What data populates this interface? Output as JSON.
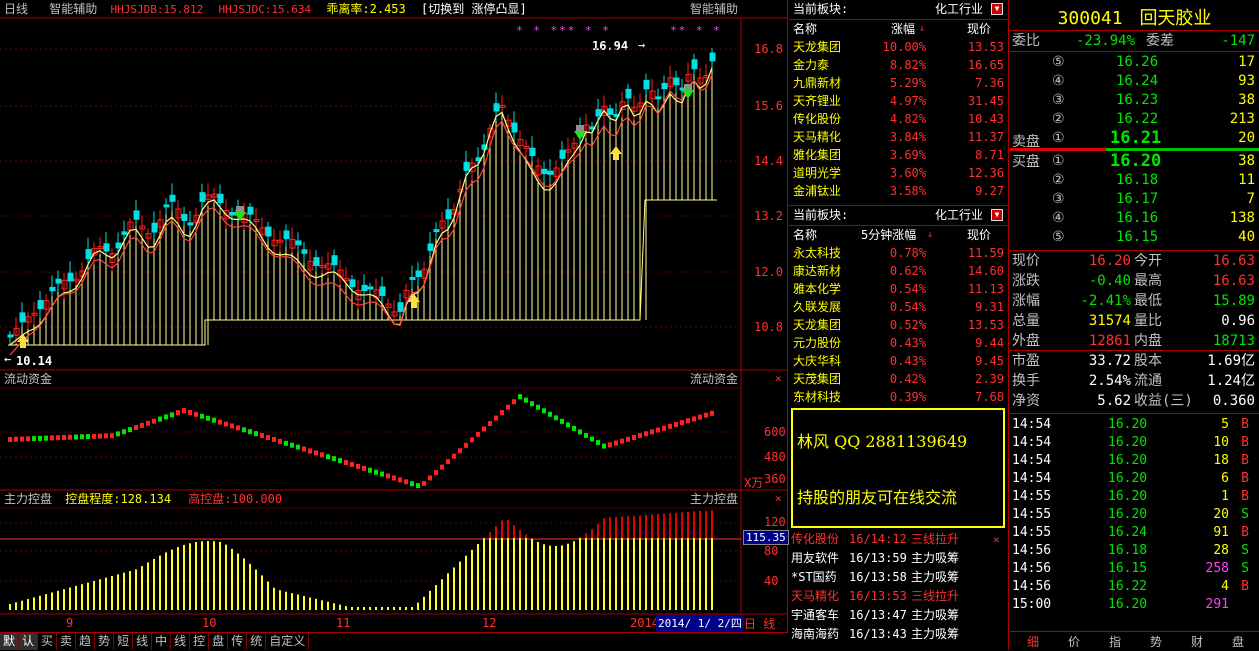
{
  "main_chart": {
    "title_left": "日线",
    "indicator_name": "智能辅助",
    "ind1_label": "HHJSJDB:15.812",
    "ind2_label": "HHJSJDC:15.634",
    "deviation": "乖离率:2.453",
    "switch_label": "[切换到 涨停凸显]",
    "title_right": "智能辅助",
    "high_label": "16.94",
    "low_label": "10.14",
    "price_ticks": [
      "16.8",
      "15.6",
      "14.4",
      "13.2",
      "12.0",
      "10.8"
    ],
    "markers": "* * *** * *",
    "markers2": "** * *"
  },
  "flow_panel": {
    "title": "流动资金",
    "title_right": "流动资金",
    "ticks": [
      "600",
      "480",
      "360"
    ],
    "unit": "X万"
  },
  "control_panel": {
    "title": "主力控盘",
    "degree": "控盘程度:128.134",
    "high": "高控盘:100.000",
    "title_right": "主力控盘",
    "ticks": [
      "120",
      "80",
      "40"
    ],
    "current": "115.35"
  },
  "x_axis": {
    "labels": [
      "9",
      "10",
      "11",
      "12",
      "2014"
    ],
    "date": "2014/ 1/ 2/四",
    "period": "日 线"
  },
  "bottom_tabs": [
    "默",
    "认",
    "买",
    "卖",
    "趋",
    "势",
    "短",
    "线",
    "中",
    "线",
    "控",
    "盘",
    "传",
    "统",
    "自定义"
  ],
  "sector1": {
    "label": "当前板块:",
    "industry": "化工行业",
    "headers": [
      "名称",
      "涨幅",
      "现价"
    ],
    "rows": [
      {
        "name": "天龙集团",
        "chg": "10.00%",
        "price": "13.53"
      },
      {
        "name": "金力泰",
        "chg": "8.82%",
        "price": "16.65"
      },
      {
        "name": "九鼎新材",
        "chg": "5.29%",
        "price": "7.36"
      },
      {
        "name": "天齐锂业",
        "chg": "4.97%",
        "price": "31.45"
      },
      {
        "name": "传化股份",
        "chg": "4.82%",
        "price": "10.43"
      },
      {
        "name": "天马精化",
        "chg": "3.84%",
        "price": "11.37"
      },
      {
        "name": "雅化集团",
        "chg": "3.69%",
        "price": "8.71"
      },
      {
        "name": "道明光学",
        "chg": "3.60%",
        "price": "12.36"
      },
      {
        "name": "金浦钛业",
        "chg": "3.58%",
        "price": "9.27"
      }
    ]
  },
  "sector2": {
    "label": "当前板块:",
    "industry": "化工行业",
    "headers": [
      "名称",
      "5分钟涨幅",
      "现价"
    ],
    "rows": [
      {
        "name": "永太科技",
        "chg": "0.78%",
        "price": "11.59"
      },
      {
        "name": "康达新材",
        "chg": "0.62%",
        "price": "14.60"
      },
      {
        "name": "雅本化学",
        "chg": "0.54%",
        "price": "11.13"
      },
      {
        "name": "久联发展",
        "chg": "0.54%",
        "price": "9.31"
      },
      {
        "name": "天龙集团",
        "chg": "0.52%",
        "price": "13.53"
      },
      {
        "name": "元力股份",
        "chg": "0.43%",
        "price": "9.44"
      },
      {
        "name": "大庆华科",
        "chg": "0.43%",
        "price": "9.45"
      },
      {
        "name": "天茂集团",
        "chg": "0.42%",
        "price": "2.39"
      },
      {
        "name": "东材科技",
        "chg": "0.39%",
        "price": "7.68"
      }
    ]
  },
  "ad_box": {
    "line1": "林风 QQ 2881139649",
    "line2": "持股的朋友可在线交流"
  },
  "alerts": [
    {
      "name": "传化股份",
      "time": "16/14:12",
      "event": "三线拉升",
      "color": "red"
    },
    {
      "name": "用友软件",
      "time": "16/13:59",
      "event": "主力吸筹",
      "color": "wht"
    },
    {
      "name": "*ST国药",
      "time": "16/13:58",
      "event": "主力吸筹",
      "color": "wht"
    },
    {
      "name": "天马精化",
      "time": "16/13:53",
      "event": "三线拉升",
      "color": "red"
    },
    {
      "name": "宇通客车",
      "time": "16/13:47",
      "event": "主力吸筹",
      "color": "wht"
    },
    {
      "name": "海南海药",
      "time": "16/13:43",
      "event": "主力吸筹",
      "color": "wht"
    }
  ],
  "quote": {
    "code": "300041",
    "name": "回天胶业",
    "wb_label": "委比",
    "wb_value": "-23.94%",
    "wc_label": "委差",
    "wc_value": "-147",
    "sell_label": "卖盘",
    "buy_label": "买盘",
    "sells": [
      {
        "lvl": "⑤",
        "price": "16.26",
        "vol": "17"
      },
      {
        "lvl": "④",
        "price": "16.24",
        "vol": "93"
      },
      {
        "lvl": "③",
        "price": "16.23",
        "vol": "38"
      },
      {
        "lvl": "②",
        "price": "16.22",
        "vol": "213"
      },
      {
        "lvl": "①",
        "price": "16.21",
        "vol": "20"
      }
    ],
    "buys": [
      {
        "lvl": "①",
        "price": "16.20",
        "vol": "38"
      },
      {
        "lvl": "②",
        "price": "16.18",
        "vol": "11"
      },
      {
        "lvl": "③",
        "price": "16.17",
        "vol": "7"
      },
      {
        "lvl": "④",
        "price": "16.16",
        "vol": "138"
      },
      {
        "lvl": "⑤",
        "price": "16.15",
        "vol": "40"
      }
    ],
    "stats": [
      {
        "l1": "现价",
        "v1": "16.20",
        "c1": "red",
        "l2": "今开",
        "v2": "16.63",
        "c2": "red"
      },
      {
        "l1": "涨跌",
        "v1": "-0.40",
        "c1": "grn",
        "l2": "最高",
        "v2": "16.63",
        "c2": "red"
      },
      {
        "l1": "涨幅",
        "v1": "-2.41%",
        "c1": "grn",
        "l2": "最低",
        "v2": "15.89",
        "c2": "grn"
      },
      {
        "l1": "总量",
        "v1": "31574",
        "c1": "yel",
        "l2": "量比",
        "v2": "0.96",
        "c2": "wht"
      },
      {
        "l1": "外盘",
        "v1": "12861",
        "c1": "red",
        "l2": "内盘",
        "v2": "18713",
        "c2": "grn"
      }
    ],
    "stats2": [
      {
        "l1": "市盈",
        "v1": "33.72",
        "l2": "股本",
        "v2": "1.69亿"
      },
      {
        "l1": "换手",
        "v1": "2.54%",
        "l2": "流通",
        "v2": "1.24亿"
      },
      {
        "l1": "净资",
        "v1": "5.62",
        "l2": "收益(三)",
        "v2": "0.360"
      }
    ],
    "ticks": [
      {
        "time": "14:54",
        "price": "16.20",
        "vol": "5",
        "bs": "B",
        "vc": "yel",
        "bc": "red"
      },
      {
        "time": "14:54",
        "price": "16.20",
        "vol": "10",
        "bs": "B",
        "vc": "yel",
        "bc": "red"
      },
      {
        "time": "14:54",
        "price": "16.20",
        "vol": "18",
        "bs": "B",
        "vc": "yel",
        "bc": "red"
      },
      {
        "time": "14:54",
        "price": "16.20",
        "vol": "6",
        "bs": "B",
        "vc": "yel",
        "bc": "red"
      },
      {
        "time": "14:55",
        "price": "16.20",
        "vol": "1",
        "bs": "B",
        "vc": "yel",
        "bc": "red"
      },
      {
        "time": "14:55",
        "price": "16.20",
        "vol": "20",
        "bs": "S",
        "vc": "yel",
        "bc": "grn"
      },
      {
        "time": "14:55",
        "price": "16.24",
        "vol": "91",
        "bs": "B",
        "vc": "yel",
        "bc": "red"
      },
      {
        "time": "14:56",
        "price": "16.18",
        "vol": "28",
        "bs": "S",
        "vc": "yel",
        "bc": "grn"
      },
      {
        "time": "14:56",
        "price": "16.15",
        "vol": "258",
        "bs": "S",
        "vc": "mag",
        "bc": "grn"
      },
      {
        "time": "14:56",
        "price": "16.22",
        "vol": "4",
        "bs": "B",
        "vc": "yel",
        "bc": "red"
      },
      {
        "time": "15:00",
        "price": "16.20",
        "vol": "291",
        "bs": "",
        "vc": "mag",
        "bc": "red"
      }
    ],
    "tabs": [
      "细",
      "价",
      "指",
      "势",
      "财",
      "盘"
    ]
  }
}
